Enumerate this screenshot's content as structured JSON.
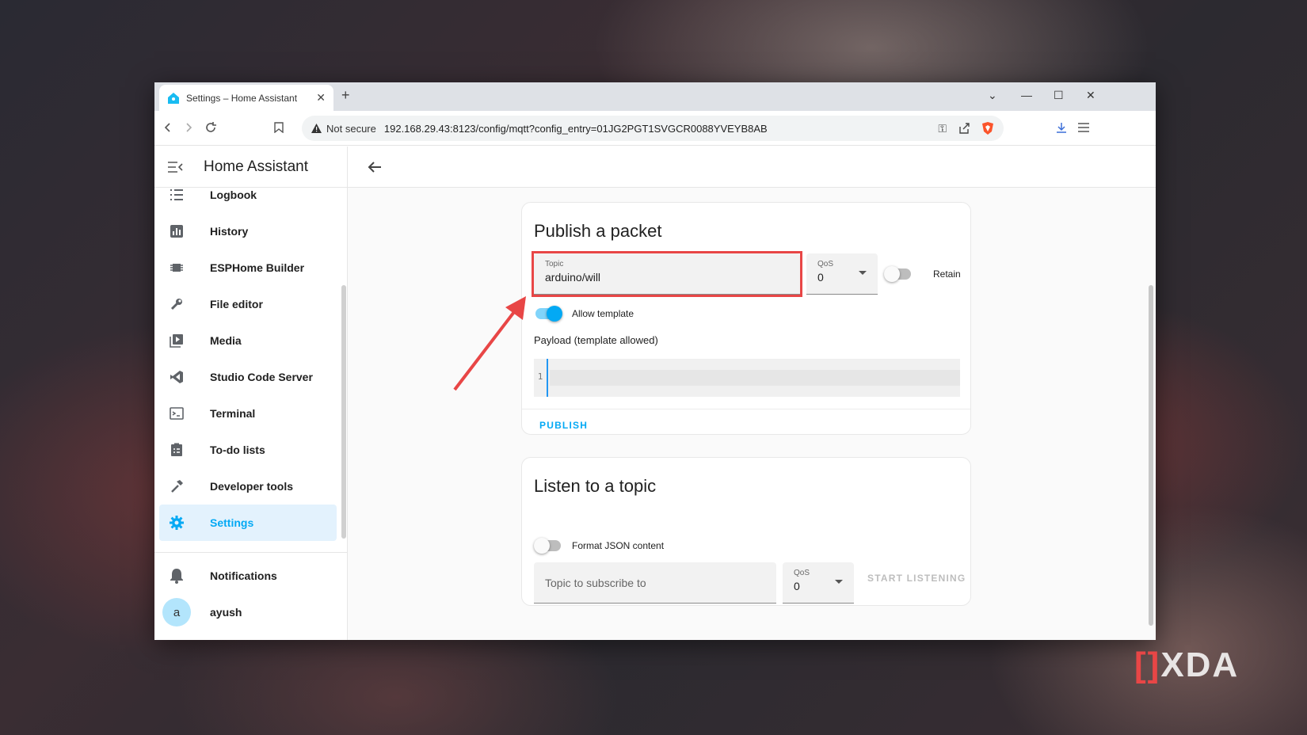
{
  "browser": {
    "tab_title": "Settings – Home Assistant",
    "security_label": "Not secure",
    "url": "192.168.29.43:8123/config/mqtt?config_entry=01JG2PGT1SVGCR0088YVEYB8AB"
  },
  "sidebar": {
    "app_title": "Home Assistant",
    "items": [
      {
        "label": "Logbook",
        "icon": "format-list-bulleted-icon"
      },
      {
        "label": "History",
        "icon": "chart-box-icon"
      },
      {
        "label": "ESPHome Builder",
        "icon": "chip-icon"
      },
      {
        "label": "File editor",
        "icon": "wrench-icon"
      },
      {
        "label": "Media",
        "icon": "play-box-multiple-icon"
      },
      {
        "label": "Studio Code Server",
        "icon": "vscode-icon"
      },
      {
        "label": "Terminal",
        "icon": "console-icon"
      },
      {
        "label": "To-do lists",
        "icon": "clipboard-list-icon"
      },
      {
        "label": "Developer tools",
        "icon": "hammer-icon"
      },
      {
        "label": "Settings",
        "icon": "cog-icon",
        "active": true
      }
    ],
    "notifications_label": "Notifications",
    "user_initial": "a",
    "user_name": "ayush"
  },
  "publish": {
    "title": "Publish a packet",
    "topic_label": "Topic",
    "topic_value": "arduino/will",
    "qos_label": "QoS",
    "qos_value": "0",
    "retain_label": "Retain",
    "retain_on": false,
    "allow_template_label": "Allow template",
    "allow_template_on": true,
    "payload_label": "Payload (template allowed)",
    "line_number": "1",
    "publish_button": "PUBLISH"
  },
  "listen": {
    "title": "Listen to a topic",
    "format_json_label": "Format JSON content",
    "format_json_on": false,
    "topic_placeholder": "Topic to subscribe to",
    "qos_label": "QoS",
    "qos_value": "0",
    "start_button": "START LISTENING"
  },
  "colors": {
    "accent": "#03a9f4",
    "highlight": "#e84646"
  },
  "watermark": "XDA"
}
